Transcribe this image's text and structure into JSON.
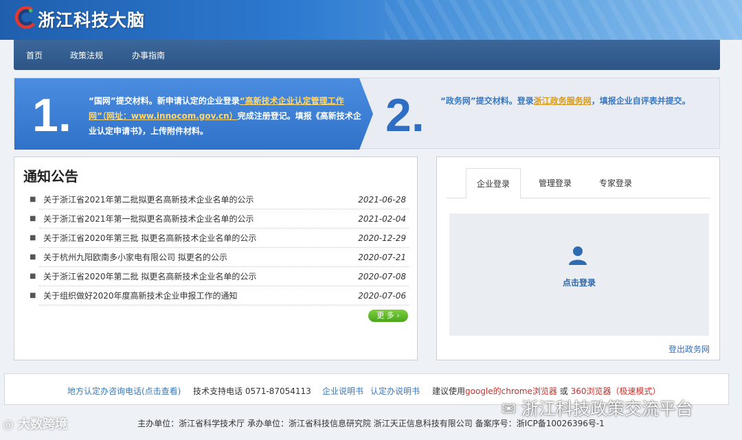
{
  "header": {
    "brand": "浙江科技大脑"
  },
  "nav": {
    "items": [
      "首页",
      "政策法规",
      "办事指南"
    ]
  },
  "steps": {
    "step1": {
      "number": "1.",
      "part1": "“国网”提交材料。新申请认定的企业登录",
      "link": "“高新技术企业认定管理工作网”（网址：www.innocom.gov.cn）",
      "part2": "完成注册登记。填报《高新技术企业认定申请书》，上传附件材料。"
    },
    "step2": {
      "number": "2.",
      "part1": "“政务网”提交材料。登录",
      "link": "浙江政务服务网",
      "part2": "，填报企业自评表并提交。"
    }
  },
  "notice": {
    "title": "通知公告",
    "items": [
      {
        "title": "关于浙江省2021年第二批拟更名高新技术企业名单的公示",
        "date": "2021-06-28"
      },
      {
        "title": "关于浙江省2021年第一批拟更名高新技术企业名单的公示",
        "date": "2021-02-04"
      },
      {
        "title": "关于浙江省2020年第三批 拟更名高新技术企业名单的公示",
        "date": "2020-12-29"
      },
      {
        "title": "关于杭州九阳欧南多小家电有限公司 拟更名的公示",
        "date": "2020-07-21"
      },
      {
        "title": "关于浙江省2020年第二批 拟更名高新技术企业名单的公示",
        "date": "2020-07-08"
      },
      {
        "title": "关于组织做好2020年度高新技术企业申报工作的通知",
        "date": "2020-07-06"
      }
    ],
    "more": "更 多"
  },
  "login": {
    "tabs": [
      "企业登录",
      "管理登录",
      "专家登录"
    ],
    "link": "点击登录",
    "logout": "登出政务网"
  },
  "footer": {
    "hotline": "地方认定办咨询电话(点击查看)",
    "support": "技术支持电话 0571-87054113",
    "manual1": "企业说明书",
    "manual2": "认定办说明书",
    "suggest": "建议使用",
    "browser1": "google的chrome浏览器",
    "or": "或",
    "browser2": "360浏览器（极速模式）",
    "copyright": "主办单位：浙江省科学技术厅 承办单位：浙江省科技信息研究院 浙江天正信息科技有限公司 备案序号：浙ICP备10026396号-1"
  },
  "watermarks": {
    "left": "大数跨境",
    "right": "浙江科技政策交流平台"
  },
  "colors": {
    "header": "#2d7ad0",
    "nav": "#2d5586",
    "step1": "#3a7fd5",
    "more": "#4aa51b"
  }
}
